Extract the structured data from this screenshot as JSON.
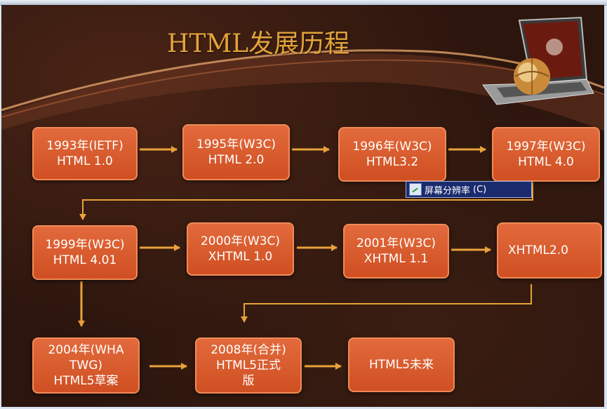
{
  "title": "HTML发展历程",
  "boxes": [
    {
      "id": "b1993",
      "text": "1993年(IETF)\nHTML 1.0"
    },
    {
      "id": "b1995",
      "text": "1995年(W3C)\nHTML 2.0"
    },
    {
      "id": "b1996",
      "text": "1996年(W3C)\nHTML3.2"
    },
    {
      "id": "b1997",
      "text": "1997年(W3C)\nHTML 4.0"
    },
    {
      "id": "b1999",
      "text": "1999年(W3C)\nHTML 4.01"
    },
    {
      "id": "b2000",
      "text": "2000年(W3C)\nXHTML 1.0"
    },
    {
      "id": "b2001",
      "text": "2001年(W3C)\nXHTML 1.1"
    },
    {
      "id": "bxhtml2",
      "text": "XHTML2.0"
    },
    {
      "id": "b2004",
      "text": "2004年(WHA\nTWG)\nHTML5草案"
    },
    {
      "id": "b2008",
      "text": "2008年(合并)\nHTML5正式\n版"
    },
    {
      "id": "bfuture",
      "text": "HTML5未来"
    }
  ],
  "tooltip": {
    "label": "屏幕分辨率",
    "suffix": "(C)",
    "icon": "chart-icon"
  },
  "colors": {
    "box": "#d95a2b",
    "arrow": "#e8a23a",
    "title": "#e2a33a"
  }
}
